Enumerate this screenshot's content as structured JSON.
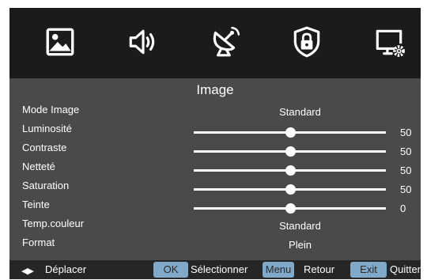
{
  "tabs": [
    {
      "icon": "image-icon"
    },
    {
      "icon": "speaker-icon"
    },
    {
      "icon": "satellite-dish-icon"
    },
    {
      "icon": "lock-shield-icon"
    },
    {
      "icon": "monitor-settings-icon"
    }
  ],
  "panel": {
    "title": "Image",
    "rows": [
      {
        "label": "Mode Image",
        "type": "value",
        "value": "Standard"
      },
      {
        "label": "Luminosité",
        "type": "slider",
        "value": "50",
        "level": 0.5
      },
      {
        "label": "Contraste",
        "type": "slider",
        "value": "50",
        "level": 0.5
      },
      {
        "label": "Netteté",
        "type": "slider",
        "value": "50",
        "level": 0.5
      },
      {
        "label": "Saturation",
        "type": "slider",
        "value": "50",
        "level": 0.5
      },
      {
        "label": "Teinte",
        "type": "slider",
        "value": "0",
        "level": 0.5
      },
      {
        "label": "Temp.couleur",
        "type": "value",
        "value": "Standard"
      },
      {
        "label": "Format",
        "type": "value",
        "value": "Plein"
      }
    ]
  },
  "footer": {
    "move_arrows": "◀▶",
    "move_label": "Déplacer",
    "ok_key": "OK",
    "ok_label": "Sélectionner",
    "menu_key": "Menu",
    "menu_label": "Retour",
    "exit_key": "Exit",
    "exit_label": "Quitter"
  },
  "colors": {
    "panel_bg": "#4a4a4a",
    "icon_bar_bg": "#1b1b1b",
    "key_bg": "#7fa8c9"
  }
}
